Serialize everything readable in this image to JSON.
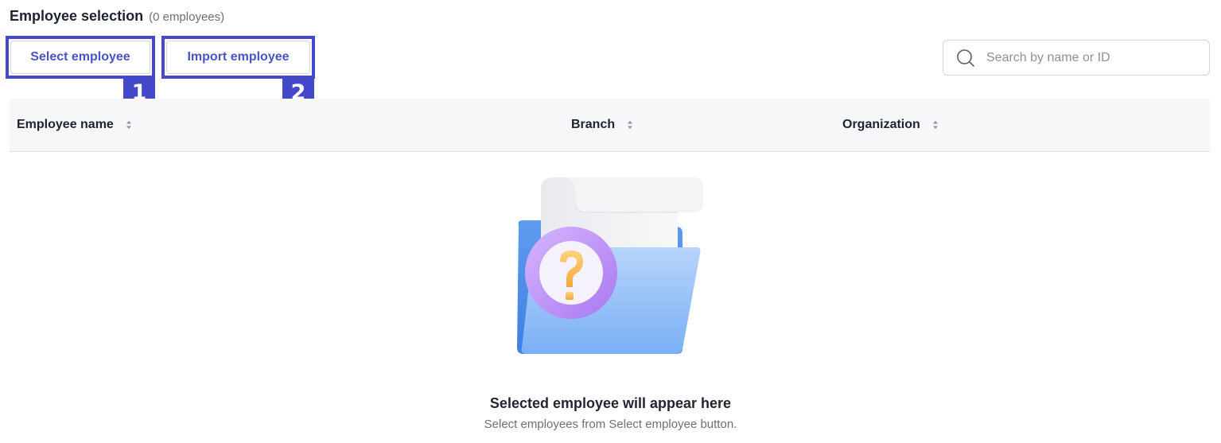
{
  "section": {
    "title": "Employee selection",
    "count": "(0 employees)"
  },
  "toolbar": {
    "select_label": "Select employee",
    "import_label": "Import employee",
    "select_marker": "1",
    "import_marker": "2",
    "marker_color": "#4349c9",
    "accent_color": "#4b52c8"
  },
  "search": {
    "placeholder": "Search by name or ID",
    "value": "",
    "icon": "search-icon"
  },
  "table": {
    "columns": [
      {
        "label": "Employee name",
        "icon": "sort-icon"
      },
      {
        "label": "Branch",
        "icon": "sort-icon"
      },
      {
        "label": "Organization",
        "icon": "sort-icon"
      }
    ],
    "rows": []
  },
  "empty_state": {
    "illustration": "folder-question-illustration",
    "title": "Selected employee will appear here",
    "subtitle": "Select employees from Select employee button."
  }
}
